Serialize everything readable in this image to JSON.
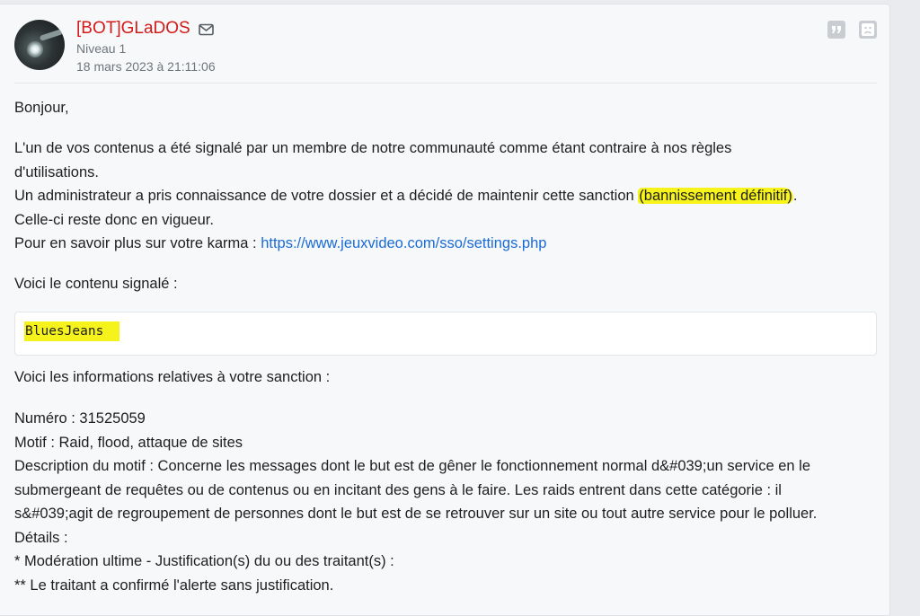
{
  "post": {
    "author": "[BOT]GLaDOS",
    "level": "Niveau 1",
    "date": "18 mars 2023 à 21:11:06",
    "icons": {
      "avatar": "glados-avatar",
      "message": "envelope-icon",
      "quote": "quote-icon",
      "report": "sad-face-icon"
    },
    "colors": {
      "author": "#d21a1a",
      "link": "#1a6bd4",
      "highlight": "#f6f31c"
    }
  },
  "body": {
    "greeting": "Bonjour,",
    "para1_line1": "L'un de vos contenus a été signalé par un membre de notre communauté comme étant contraire à nos règles",
    "para1_line2": "d'utilisations.",
    "para1_line3_pre": "Un administrateur a pris connaissance de votre dossier et a décidé de maintenir cette sanction ",
    "para1_line3_hl": "(bannissement définitif)",
    "para1_line3_post": ".",
    "para1_line4": "Celle-ci reste donc en vigueur.",
    "para1_line5_pre": "Pour en savoir plus sur votre karma : ",
    "para1_link": "https://www.jeuxvideo.com/sso/settings.php",
    "reported_label": "Voici le contenu signalé :",
    "reported_content": "BluesJeans",
    "sanction_label": "Voici les informations relatives à votre sanction :",
    "numero": "Numéro : 31525059",
    "motif": "Motif : Raid, flood, attaque de sites",
    "desc_line1": "Description du motif : Concerne les messages dont le but est de gêner le fonctionnement normal d&#039;un service en le",
    "desc_line2": "submergeant de requêtes ou de contenus ou en incitant des gens à le faire. Les raids entrent dans cette catégorie : il",
    "desc_line3": "s&#039;agit de regroupement de personnes dont le but est de se retrouver sur un site ou tout autre service pour le polluer.",
    "details": "Détails :",
    "moderation": "* Modération ultime - Justification(s) du ou des traitant(s) :",
    "confirm": "** Le traitant a confirmé l'alerte sans justification."
  }
}
